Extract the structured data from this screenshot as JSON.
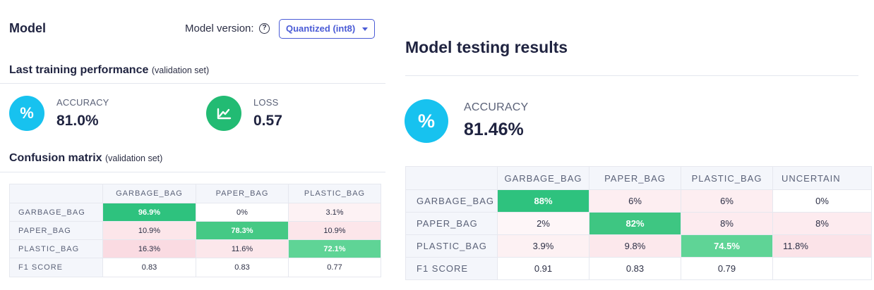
{
  "model_panel": {
    "title": "Model",
    "version_label": "Model version:",
    "help_glyph": "?",
    "version_value": "Quantized (int8)",
    "training": {
      "heading": "Last training performance",
      "heading_note": "(validation set)",
      "accuracy": {
        "icon": "percent-icon",
        "glyph": "%",
        "label": "ACCURACY",
        "value": "81.0%",
        "color": "#17c2ef"
      },
      "loss": {
        "icon": "chart-line-icon",
        "label": "LOSS",
        "value": "0.57",
        "color": "#22bb73"
      }
    },
    "confusion": {
      "heading": "Confusion matrix",
      "heading_note": "(validation set)",
      "columns": [
        "GARBAGE_BAG",
        "PAPER_BAG",
        "PLASTIC_BAG"
      ],
      "rows": [
        {
          "label": "GARBAGE_BAG",
          "cells": [
            "96.9%",
            "0%",
            "3.1%"
          ]
        },
        {
          "label": "PAPER_BAG",
          "cells": [
            "10.9%",
            "78.3%",
            "10.9%"
          ]
        },
        {
          "label": "PLASTIC_BAG",
          "cells": [
            "16.3%",
            "11.6%",
            "72.1%"
          ]
        }
      ],
      "f1": {
        "label": "F1 SCORE",
        "cells": [
          "0.83",
          "0.83",
          "0.77"
        ]
      }
    }
  },
  "testing_panel": {
    "title": "Model testing results",
    "accuracy": {
      "icon": "percent-icon",
      "glyph": "%",
      "label": "ACCURACY",
      "value": "81.46%",
      "color": "#17c2ef"
    },
    "confusion": {
      "columns": [
        "GARBAGE_BAG",
        "PAPER_BAG",
        "PLASTIC_BAG",
        "UNCERTAIN"
      ],
      "rows": [
        {
          "label": "GARBAGE_BAG",
          "cells": [
            "88%",
            "6%",
            "6%",
            "0%"
          ]
        },
        {
          "label": "PAPER_BAG",
          "cells": [
            "2%",
            "82%",
            "8%",
            "8%"
          ]
        },
        {
          "label": "PLASTIC_BAG",
          "cells": [
            "3.9%",
            "9.8%",
            "74.5%",
            "11.8%"
          ]
        }
      ],
      "f1": {
        "label": "F1 SCORE",
        "cells": [
          "0.91",
          "0.83",
          "0.79",
          ""
        ]
      }
    }
  },
  "colors": {
    "diagonal_strong": "#2ec27e",
    "diagonal_medium": "#5fd496",
    "offdiag_light": "#fdecef",
    "offdiag_medium": "#fbdfe5",
    "offdiag_strong": "#fad3dc",
    "accent": "#4a5bd6"
  }
}
